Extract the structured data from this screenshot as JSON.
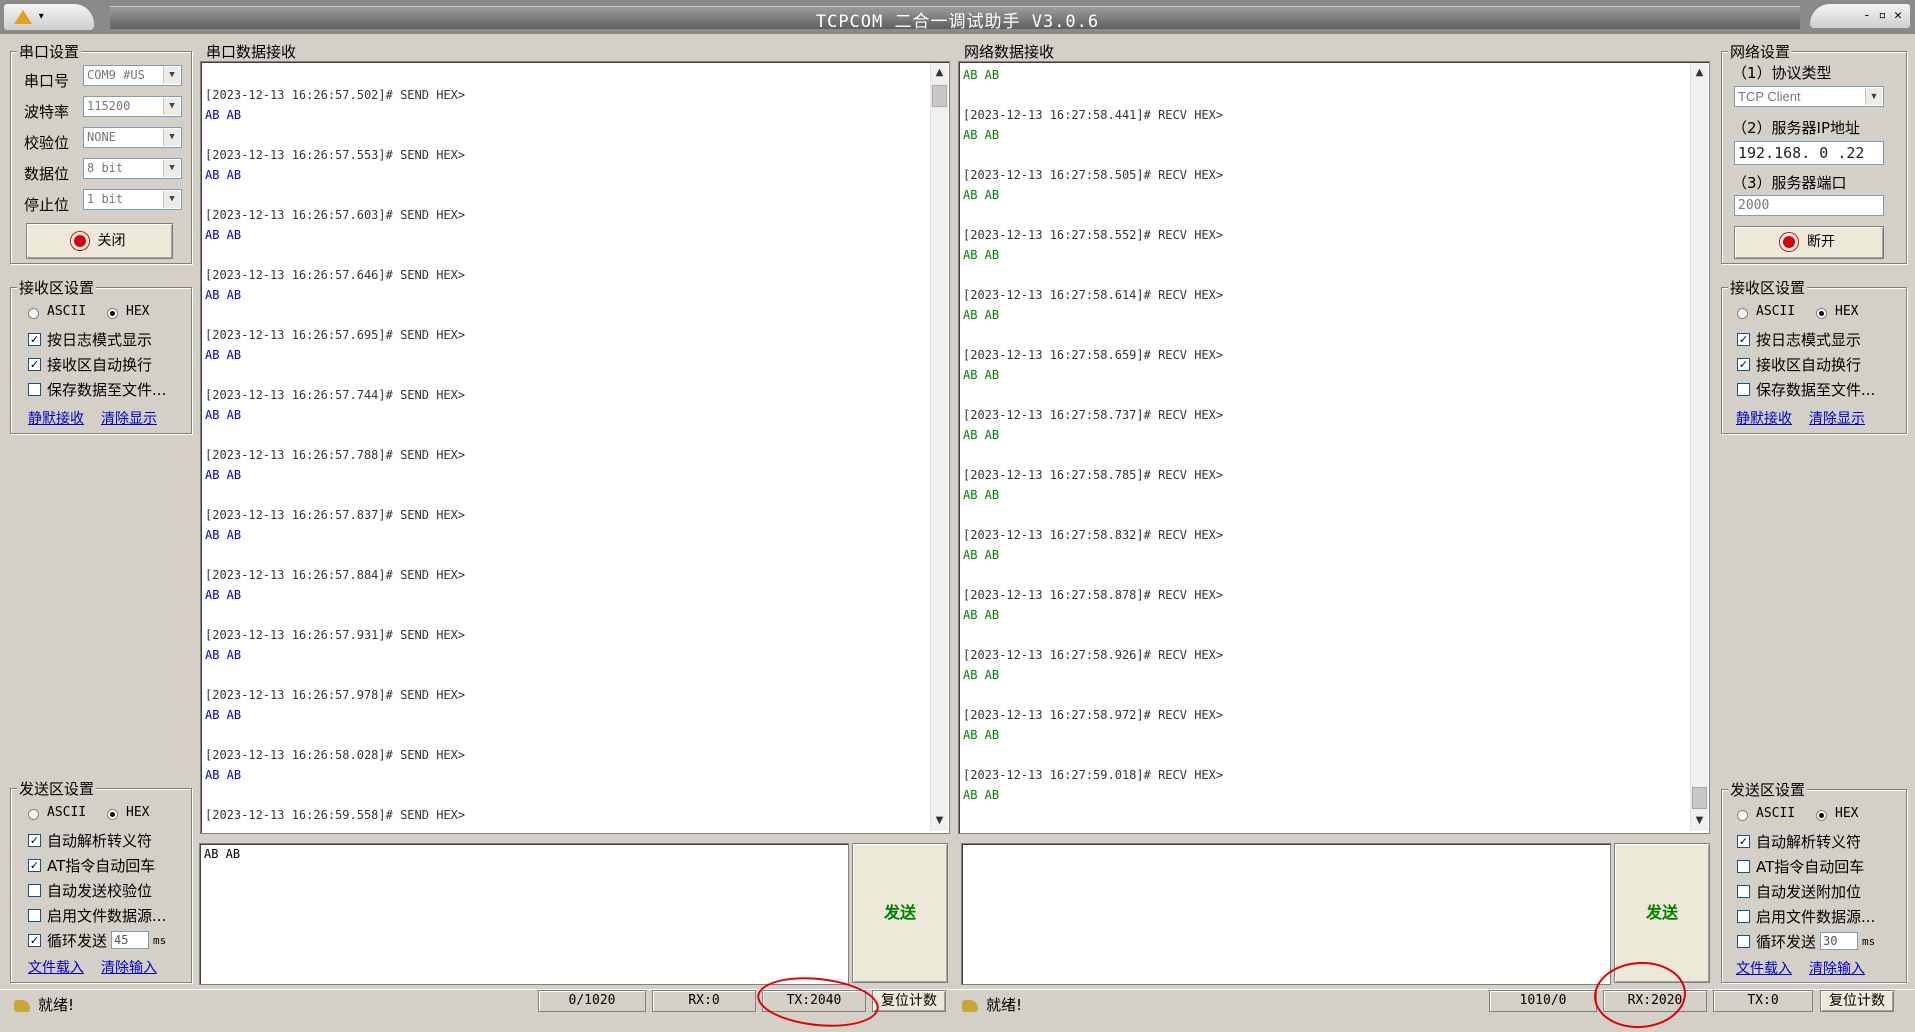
{
  "window": {
    "title": "TCPCOM 二合一调试助手  V3.0.6",
    "controls": "- ▫ ✕"
  },
  "serial_settings": {
    "title": "串口设置",
    "port_label": "串口号",
    "port_value": "COM9 #US",
    "baud_label": "波特率",
    "baud_value": "115200",
    "parity_label": "校验位",
    "parity_value": "NONE",
    "databits_label": "数据位",
    "databits_value": "8 bit",
    "stopbits_label": "停止位",
    "stopbits_value": "1 bit",
    "close_button": "关闭"
  },
  "serial_recv_settings": {
    "title": "接收区设置",
    "ascii": "ASCII",
    "hex": "HEX",
    "log_mode": "按日志模式显示",
    "auto_wrap": "接收区自动换行",
    "save_file": "保存数据至文件...",
    "silent_recv": "静默接收",
    "clear_display": "清除显示"
  },
  "serial_send_settings": {
    "title": "发送区设置",
    "ascii": "ASCII",
    "hex": "HEX",
    "auto_escape": "自动解析转义符",
    "at_return": "AT指令自动回车",
    "auto_checksum": "自动发送校验位",
    "file_source": "启用文件数据源...",
    "loop_send": "循环发送",
    "loop_interval": "45",
    "ms": "ms",
    "load_file": "文件载入",
    "clear_input": "清除输入"
  },
  "serial_recv": {
    "title": "串口数据接收",
    "entries": [
      {
        "time": "[2023-12-13 16:26:57.502]# SEND HEX>",
        "data": "AB AB"
      },
      {
        "time": "[2023-12-13 16:26:57.553]# SEND HEX>",
        "data": "AB AB"
      },
      {
        "time": "[2023-12-13 16:26:57.603]# SEND HEX>",
        "data": "AB AB"
      },
      {
        "time": "[2023-12-13 16:26:57.646]# SEND HEX>",
        "data": "AB AB"
      },
      {
        "time": "[2023-12-13 16:26:57.695]# SEND HEX>",
        "data": "AB AB"
      },
      {
        "time": "[2023-12-13 16:26:57.744]# SEND HEX>",
        "data": "AB AB"
      },
      {
        "time": "[2023-12-13 16:26:57.788]# SEND HEX>",
        "data": "AB AB"
      },
      {
        "time": "[2023-12-13 16:26:57.837]# SEND HEX>",
        "data": "AB AB"
      },
      {
        "time": "[2023-12-13 16:26:57.884]# SEND HEX>",
        "data": "AB AB"
      },
      {
        "time": "[2023-12-13 16:26:57.931]# SEND HEX>",
        "data": "AB AB"
      },
      {
        "time": "[2023-12-13 16:26:57.978]# SEND HEX>",
        "data": "AB AB"
      },
      {
        "time": "[2023-12-13 16:26:58.028]# SEND HEX>",
        "data": "AB AB"
      },
      {
        "time": "[2023-12-13 16:26:59.558]# SEND HEX>",
        "data": ""
      }
    ]
  },
  "net_recv": {
    "title": "网络数据接收",
    "first_data": "AB AB",
    "entries": [
      {
        "time": "[2023-12-13 16:27:58.441]# RECV HEX>",
        "data": "AB AB"
      },
      {
        "time": "[2023-12-13 16:27:58.505]# RECV HEX>",
        "data": "AB AB"
      },
      {
        "time": "[2023-12-13 16:27:58.552]# RECV HEX>",
        "data": "AB AB"
      },
      {
        "time": "[2023-12-13 16:27:58.614]# RECV HEX>",
        "data": "AB AB"
      },
      {
        "time": "[2023-12-13 16:27:58.659]# RECV HEX>",
        "data": "AB AB"
      },
      {
        "time": "[2023-12-13 16:27:58.737]# RECV HEX>",
        "data": "AB AB"
      },
      {
        "time": "[2023-12-13 16:27:58.785]# RECV HEX>",
        "data": "AB AB"
      },
      {
        "time": "[2023-12-13 16:27:58.832]# RECV HEX>",
        "data": "AB AB"
      },
      {
        "time": "[2023-12-13 16:27:58.878]# RECV HEX>",
        "data": "AB AB"
      },
      {
        "time": "[2023-12-13 16:27:58.926]# RECV HEX>",
        "data": "AB AB"
      },
      {
        "time": "[2023-12-13 16:27:58.972]# RECV HEX>",
        "data": "AB AB"
      },
      {
        "time": "[2023-12-13 16:27:59.018]# RECV HEX>",
        "data": "AB AB"
      }
    ]
  },
  "serial_send": {
    "content": "AB AB",
    "send_button": "发送"
  },
  "net_send": {
    "content": "",
    "send_button": "发送"
  },
  "net_settings": {
    "title": "网络设置",
    "protocol_label": "（1）协议类型",
    "protocol_value": "TCP Client",
    "ip_label": "（2）服务器IP地址",
    "ip_value": "192.168. 0 .22",
    "port_label": "（3）服务器端口",
    "port_value": "2000",
    "disconnect_button": "断开"
  },
  "net_recv_settings": {
    "title": "接收区设置",
    "ascii": "ASCII",
    "hex": "HEX",
    "log_mode": "按日志模式显示",
    "auto_wrap": "接收区自动换行",
    "save_file": "保存数据至文件...",
    "silent_recv": "静默接收",
    "clear_display": "清除显示"
  },
  "net_send_settings": {
    "title": "发送区设置",
    "ascii": "ASCII",
    "hex": "HEX",
    "auto_escape": "自动解析转义符",
    "at_return": "AT指令自动回车",
    "auto_append": "自动发送附加位",
    "file_source": "启用文件数据源...",
    "loop_send": "循环发送",
    "loop_interval": "30",
    "ms": "ms",
    "load_file": "文件载入",
    "clear_input": "清除输入"
  },
  "status_left": {
    "ready": "就绪!",
    "count": "0/1020",
    "rx": "RX:0",
    "tx": "TX:2040",
    "reset": "复位计数"
  },
  "status_right": {
    "ready": "就绪!",
    "count": "1010/0",
    "rx": "RX:2020",
    "tx": "TX:0",
    "reset": "复位计数"
  },
  "colors": {
    "serial_hex": "#0000cc",
    "net_hex": "#008000",
    "annotation": "#e00000"
  }
}
